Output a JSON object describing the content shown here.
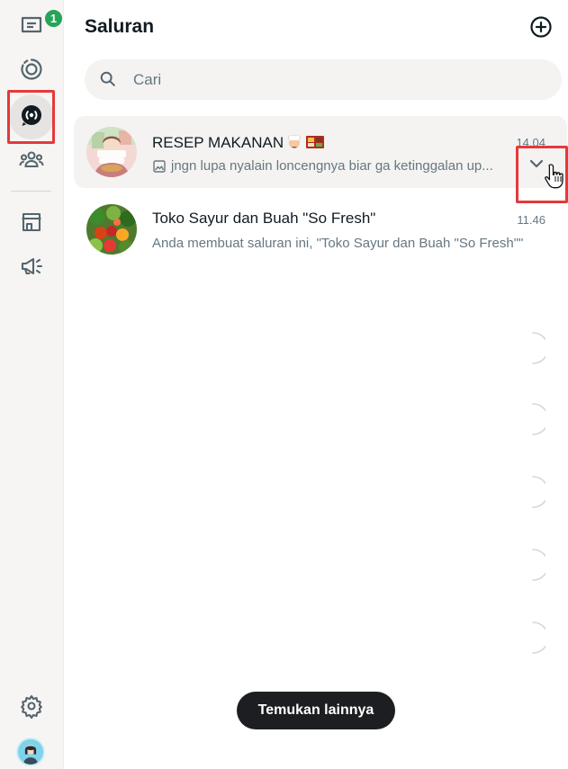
{
  "rail": {
    "chats_badge": "1",
    "items": [
      {
        "icon": "chats-icon"
      },
      {
        "icon": "status-icon"
      },
      {
        "icon": "channels-icon"
      },
      {
        "icon": "communities-icon"
      },
      {
        "icon": "store-icon"
      },
      {
        "icon": "megaphone-icon"
      },
      {
        "icon": "settings-icon"
      }
    ]
  },
  "header": {
    "title": "Saluran"
  },
  "search": {
    "placeholder": "Cari"
  },
  "channels": [
    {
      "name": "RESEP MAKANAN",
      "time": "14.04",
      "preview": "jngn lupa nyalain loncengnya biar ga ketinggalan up..."
    },
    {
      "name": "Toko Sayur dan Buah \"So Fresh\"",
      "time": "11.46",
      "preview": "Anda membuat saluran ini, \"Toko Sayur dan Buah \"So Fresh\"\""
    }
  ],
  "footer": {
    "find_more_label": "Temukan lainnya"
  },
  "colors": {
    "accent_badge": "#25a45a",
    "highlight": "#e5393b",
    "button_dark": "#1c1e21"
  }
}
